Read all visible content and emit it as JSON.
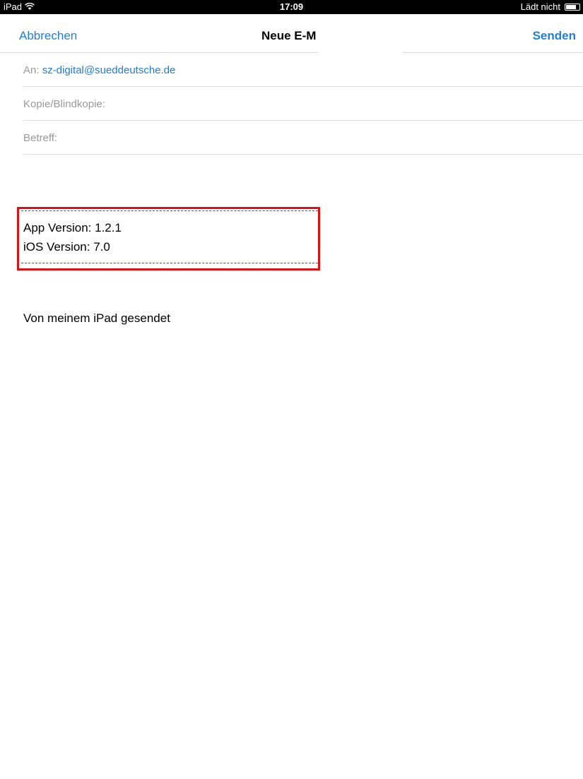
{
  "status_bar": {
    "device": "iPad",
    "time": "17:09",
    "charging": "Lädt nicht"
  },
  "nav": {
    "cancel_label": "Abbrechen",
    "title": "Neue E-M",
    "send_label": "Senden"
  },
  "fields": {
    "to_label": "An:",
    "to_value": "sz-digital@sueddeutsche.de",
    "cc_label": "Kopie/Blindkopie:",
    "subject_label": "Betreff:"
  },
  "body": {
    "app_version": "App Version: 1.2.1",
    "ios_version": "iOS Version: 7.0",
    "signature": "Von meinem iPad gesendet"
  },
  "colors": {
    "accent": "#1e7ee0",
    "highlight": "#e01010"
  },
  "icons": [
    "wifi-icon",
    "battery-icon"
  ]
}
